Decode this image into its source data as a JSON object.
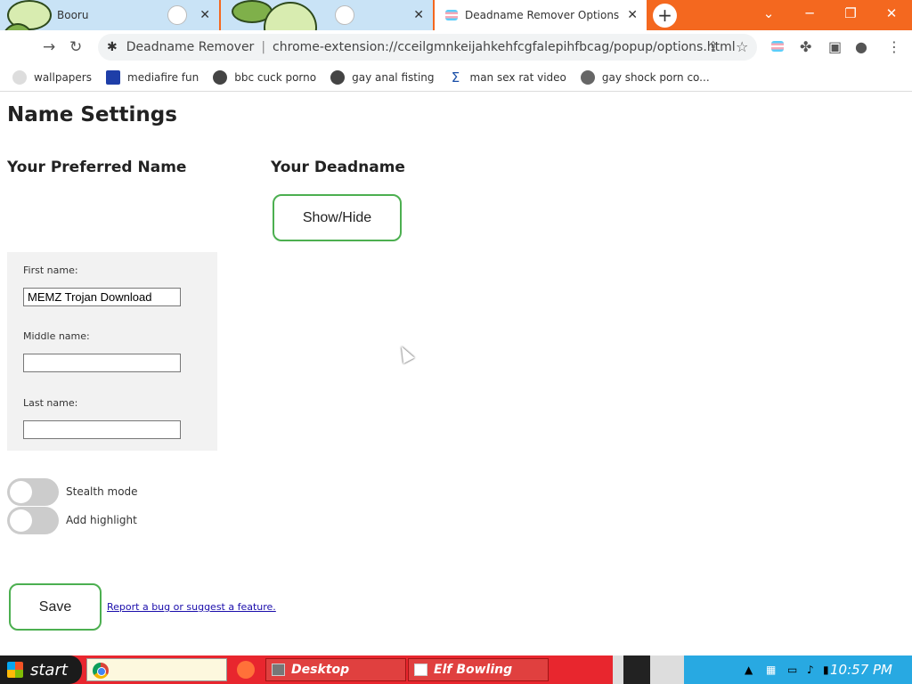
{
  "browser": {
    "tabs": [
      {
        "title": "Booru",
        "close": "✕"
      },
      {
        "title": "",
        "close": "✕"
      },
      {
        "title": "Deadname Remover Options",
        "close": "✕",
        "active": true
      }
    ],
    "new_tab": "+",
    "window_controls": {
      "dropdown": "⌄",
      "minimize": "─",
      "restore": "❐",
      "close": "✕"
    },
    "address": {
      "site_name": "Deadname Remover",
      "separator": "|",
      "url": "chrome-extension://cceilgmnkeijahkehfcgfalepihfbcag/popup/options.html"
    },
    "bookmarks": [
      {
        "label": "wallpapers",
        "icon": "reddit-icon"
      },
      {
        "label": "mediafire fun",
        "icon": "mediafire-icon"
      },
      {
        "label": "bbc cuck porno",
        "icon": "globe-icon"
      },
      {
        "label": "gay anal fisting",
        "icon": "globe-icon"
      },
      {
        "label": "man sex rat video",
        "icon": "sigma-icon"
      },
      {
        "label": "gay shock porn co...",
        "icon": "skull-icon"
      }
    ]
  },
  "page": {
    "title": "Name Settings",
    "preferred_heading": "Your Preferred Name",
    "deadname_heading": "Your Deadname",
    "show_hide_label": "Show/Hide",
    "fields": {
      "first_label": "First name:",
      "first_value": "MEMZ Trojan Download",
      "middle_label": "Middle name:",
      "middle_value": "",
      "last_label": "Last name:",
      "last_value": ""
    },
    "toggles": {
      "stealth_label": "Stealth mode",
      "stealth_on": false,
      "highlight_label": "Add highlight",
      "highlight_on": false
    },
    "save_label": "Save",
    "report_link": "Report a bug or suggest a feature."
  },
  "taskbar": {
    "start_label": "start",
    "tasks": [
      {
        "label": "Desktop"
      },
      {
        "label": "Elf Bowling"
      }
    ],
    "clock": "10:57 PM"
  },
  "colors": {
    "tabstrip": "#f4681f",
    "button_border": "#4caf50",
    "taskbar": "#e8262e",
    "tray": "#28a9e2"
  }
}
